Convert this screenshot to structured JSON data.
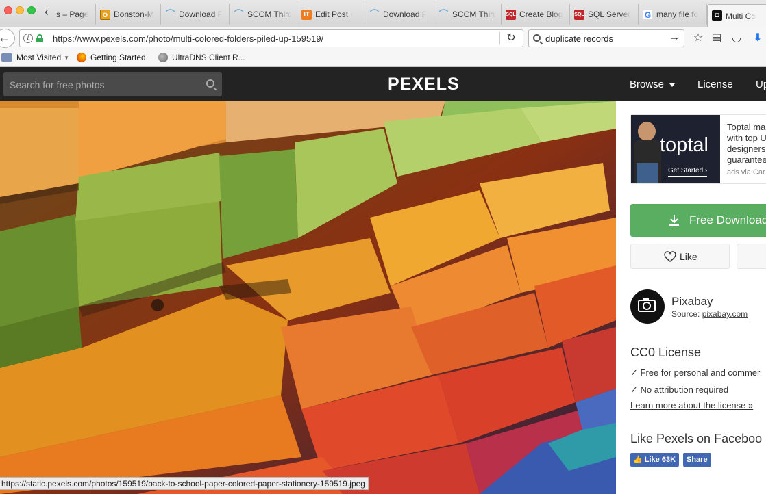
{
  "browser": {
    "tab_scroll_icon": "chevron-left-icon",
    "tabs": [
      {
        "label": "s – Page",
        "favicon": "none"
      },
      {
        "label": "Donston-M",
        "favicon": "orange-square-icon"
      },
      {
        "label": "Download F",
        "favicon": "arc-icon"
      },
      {
        "label": "SCCM Third",
        "favicon": "arc-icon"
      },
      {
        "label": "Edit Post ‹",
        "favicon": "it-icon"
      },
      {
        "label": "Download F",
        "favicon": "arc-icon"
      },
      {
        "label": "SCCM Third",
        "favicon": "arc-icon"
      },
      {
        "label": "Create Blog",
        "favicon": "sql-icon"
      },
      {
        "label": "SQL Server",
        "favicon": "sql-icon"
      },
      {
        "label": "many file fo",
        "favicon": "google-icon"
      },
      {
        "label": "Multi Co",
        "favicon": "pexels-icon",
        "active": true
      }
    ],
    "url": "https://www.pexels.com/photo/multi-colored-folders-piled-up-159519/",
    "search_value": "duplicate records",
    "bookmarks": [
      {
        "label": "Most Visited",
        "icon": "folder-icon",
        "dropdown": true
      },
      {
        "label": "Getting Started",
        "icon": "firefox-icon"
      },
      {
        "label": "UltraDNS Client R...",
        "icon": "globe-icon"
      }
    ],
    "status_url": "https://static.pexels.com/photos/159519/back-to-school-paper-colored-paper-stationery-159519.jpeg"
  },
  "pexels": {
    "search_placeholder": "Search for free photos",
    "logo": "PEXELS",
    "nav": {
      "browse": "Browse",
      "license": "License",
      "upload": "Up"
    },
    "ad": {
      "brand": "toptal",
      "cta": "Get Started ›",
      "text_lines": [
        "Toptal ma",
        "with top U",
        "designers",
        "guarantee"
      ],
      "via": "ads via Car"
    },
    "download_label": "Free Download",
    "like_label": "Like",
    "author": {
      "name": "Pixabay",
      "source_prefix": "Source: ",
      "source_link": "pixabay.com",
      "avatar_text": "pixabay"
    },
    "license": {
      "title": "CC0 License",
      "items": [
        "✓ Free for personal and commer",
        "✓ No attribution required"
      ],
      "more": "Learn more about the license »"
    },
    "facebook": {
      "title": "Like Pexels on Faceboo",
      "like_label": "Like 63K",
      "share_label": "Share"
    }
  },
  "colors": {
    "pexels_green": "#5aae61",
    "pexels_header": "#232323",
    "facebook_blue": "#4267b2"
  }
}
